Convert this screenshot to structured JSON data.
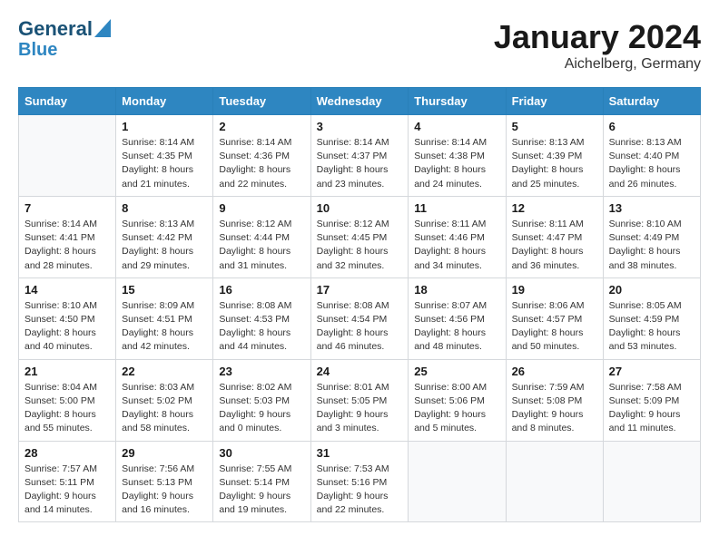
{
  "header": {
    "logo_line1": "General",
    "logo_line2": "Blue",
    "title": "January 2024",
    "subtitle": "Aichelberg, Germany"
  },
  "days_of_week": [
    "Sunday",
    "Monday",
    "Tuesday",
    "Wednesday",
    "Thursday",
    "Friday",
    "Saturday"
  ],
  "weeks": [
    [
      {
        "day": "",
        "info": ""
      },
      {
        "day": "1",
        "info": "Sunrise: 8:14 AM\nSunset: 4:35 PM\nDaylight: 8 hours\nand 21 minutes."
      },
      {
        "day": "2",
        "info": "Sunrise: 8:14 AM\nSunset: 4:36 PM\nDaylight: 8 hours\nand 22 minutes."
      },
      {
        "day": "3",
        "info": "Sunrise: 8:14 AM\nSunset: 4:37 PM\nDaylight: 8 hours\nand 23 minutes."
      },
      {
        "day": "4",
        "info": "Sunrise: 8:14 AM\nSunset: 4:38 PM\nDaylight: 8 hours\nand 24 minutes."
      },
      {
        "day": "5",
        "info": "Sunrise: 8:13 AM\nSunset: 4:39 PM\nDaylight: 8 hours\nand 25 minutes."
      },
      {
        "day": "6",
        "info": "Sunrise: 8:13 AM\nSunset: 4:40 PM\nDaylight: 8 hours\nand 26 minutes."
      }
    ],
    [
      {
        "day": "7",
        "info": ""
      },
      {
        "day": "8",
        "info": "Sunrise: 8:13 AM\nSunset: 4:42 PM\nDaylight: 8 hours\nand 29 minutes."
      },
      {
        "day": "9",
        "info": "Sunrise: 8:12 AM\nSunset: 4:44 PM\nDaylight: 8 hours\nand 31 minutes."
      },
      {
        "day": "10",
        "info": "Sunrise: 8:12 AM\nSunset: 4:45 PM\nDaylight: 8 hours\nand 32 minutes."
      },
      {
        "day": "11",
        "info": "Sunrise: 8:11 AM\nSunset: 4:46 PM\nDaylight: 8 hours\nand 34 minutes."
      },
      {
        "day": "12",
        "info": "Sunrise: 8:11 AM\nSunset: 4:47 PM\nDaylight: 8 hours\nand 36 minutes."
      },
      {
        "day": "13",
        "info": "Sunrise: 8:10 AM\nSunset: 4:49 PM\nDaylight: 8 hours\nand 38 minutes."
      }
    ],
    [
      {
        "day": "14",
        "info": ""
      },
      {
        "day": "15",
        "info": "Sunrise: 8:09 AM\nSunset: 4:51 PM\nDaylight: 8 hours\nand 42 minutes."
      },
      {
        "day": "16",
        "info": "Sunrise: 8:08 AM\nSunset: 4:53 PM\nDaylight: 8 hours\nand 44 minutes."
      },
      {
        "day": "17",
        "info": "Sunrise: 8:08 AM\nSunset: 4:54 PM\nDaylight: 8 hours\nand 46 minutes."
      },
      {
        "day": "18",
        "info": "Sunrise: 8:07 AM\nSunset: 4:56 PM\nDaylight: 8 hours\nand 48 minutes."
      },
      {
        "day": "19",
        "info": "Sunrise: 8:06 AM\nSunset: 4:57 PM\nDaylight: 8 hours\nand 50 minutes."
      },
      {
        "day": "20",
        "info": "Sunrise: 8:05 AM\nSunset: 4:59 PM\nDaylight: 8 hours\nand 53 minutes."
      }
    ],
    [
      {
        "day": "21",
        "info": ""
      },
      {
        "day": "22",
        "info": "Sunrise: 8:03 AM\nSunset: 5:02 PM\nDaylight: 8 hours\nand 58 minutes."
      },
      {
        "day": "23",
        "info": "Sunrise: 8:02 AM\nSunset: 5:03 PM\nDaylight: 9 hours\nand 0 minutes."
      },
      {
        "day": "24",
        "info": "Sunrise: 8:01 AM\nSunset: 5:05 PM\nDaylight: 9 hours\nand 3 minutes."
      },
      {
        "day": "25",
        "info": "Sunrise: 8:00 AM\nSunset: 5:06 PM\nDaylight: 9 hours\nand 5 minutes."
      },
      {
        "day": "26",
        "info": "Sunrise: 7:59 AM\nSunset: 5:08 PM\nDaylight: 9 hours\nand 8 minutes."
      },
      {
        "day": "27",
        "info": "Sunrise: 7:58 AM\nSunset: 5:09 PM\nDaylight: 9 hours\nand 11 minutes."
      }
    ],
    [
      {
        "day": "28",
        "info": ""
      },
      {
        "day": "29",
        "info": "Sunrise: 7:56 AM\nSunset: 5:13 PM\nDaylight: 9 hours\nand 16 minutes."
      },
      {
        "day": "30",
        "info": "Sunrise: 7:55 AM\nSunset: 5:14 PM\nDaylight: 9 hours\nand 19 minutes."
      },
      {
        "day": "31",
        "info": "Sunrise: 7:53 AM\nSunset: 5:16 PM\nDaylight: 9 hours\nand 22 minutes."
      },
      {
        "day": "",
        "info": ""
      },
      {
        "day": "",
        "info": ""
      },
      {
        "day": "",
        "info": ""
      }
    ]
  ],
  "week1_sunday": "Sunrise: 8:14 AM\nSunset: 4:41 PM\nDaylight: 8 hours\nand 28 minutes.",
  "week2_sunday": "Sunrise: 8:10 AM\nSunset: 4:50 PM\nDaylight: 8 hours\nand 40 minutes.",
  "week3_sunday": "Sunrise: 8:04 AM\nSunset: 5:00 PM\nDaylight: 8 hours\nand 55 minutes.",
  "week4_sunday": "Sunrise: 7:57 AM\nSunset: 5:11 PM\nDaylight: 9 hours\nand 14 minutes."
}
